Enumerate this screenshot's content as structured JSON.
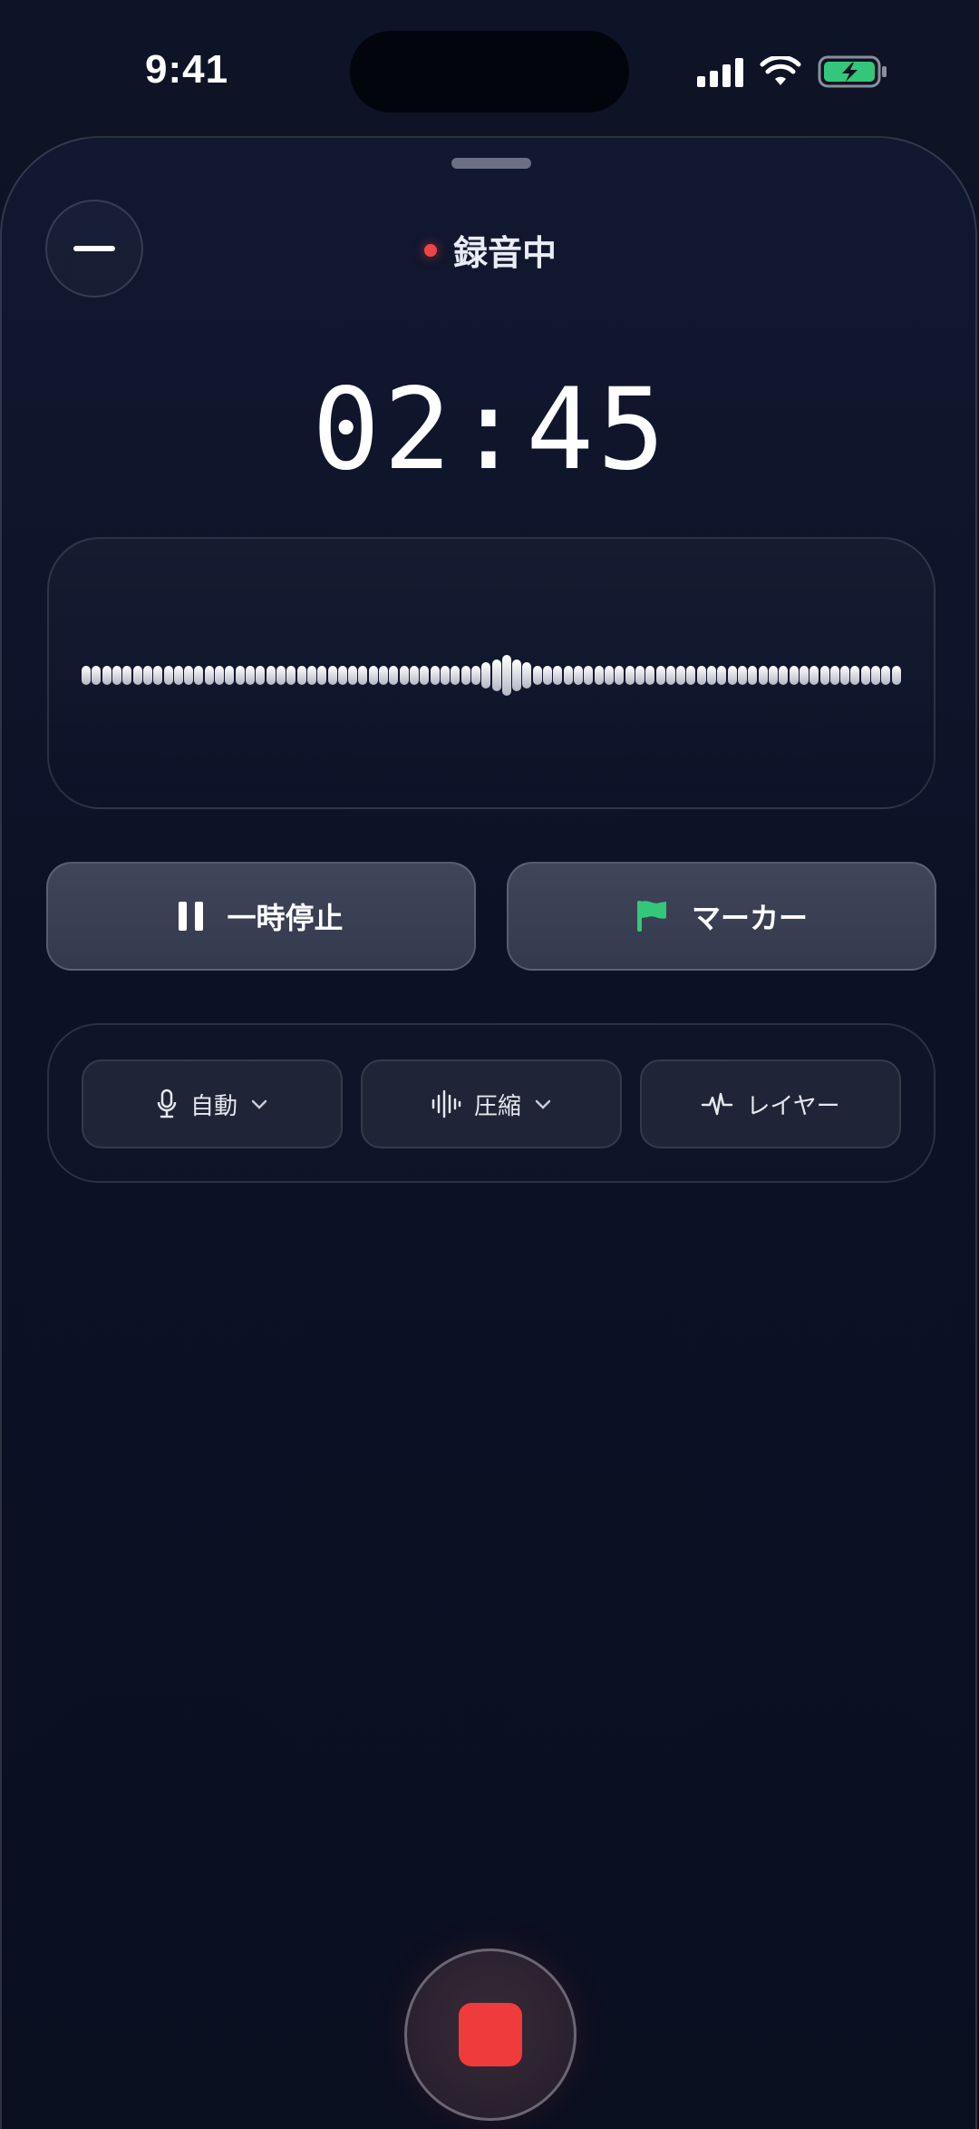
{
  "status_bar": {
    "time": "9:41",
    "icons": [
      "cellular-signal-icon",
      "wifi-icon",
      "battery-charging-icon"
    ],
    "battery_color": "#34c77b"
  },
  "header": {
    "minimize_icon": "minus-icon",
    "status_label": "録音中",
    "status_dot_color": "#ef4444"
  },
  "timer": {
    "elapsed": "02:45"
  },
  "waveform": {
    "bar_levels": [
      0.4,
      0.4,
      0.4,
      0.4,
      0.4,
      0.4,
      0.4,
      0.4,
      0.4,
      0.4,
      0.4,
      0.4,
      0.4,
      0.4,
      0.4,
      0.4,
      0.4,
      0.4,
      0.4,
      0.4,
      0.4,
      0.4,
      0.4,
      0.4,
      0.4,
      0.4,
      0.4,
      0.4,
      0.4,
      0.4,
      0.4,
      0.4,
      0.4,
      0.4,
      0.4,
      0.4,
      0.4,
      0.4,
      0.4,
      0.45,
      0.55,
      0.7,
      0.55,
      0.45,
      0.4,
      0.4,
      0.4,
      0.4,
      0.4,
      0.4,
      0.4,
      0.4,
      0.4,
      0.4,
      0.4,
      0.4,
      0.4,
      0.4,
      0.4,
      0.4,
      0.4,
      0.4,
      0.4,
      0.4,
      0.4,
      0.4,
      0.4,
      0.4,
      0.4,
      0.4,
      0.4,
      0.4,
      0.4,
      0.4,
      0.4,
      0.4,
      0.4,
      0.4,
      0.4,
      0.4
    ]
  },
  "controls": {
    "pause_label": "一時停止",
    "pause_icon": "pause-icon",
    "marker_label": "マーカー",
    "marker_icon": "flag-icon",
    "marker_icon_color": "#34c77b"
  },
  "options": [
    {
      "label": "自動",
      "icon": "microphone-icon",
      "has_dropdown": true
    },
    {
      "label": "圧縮",
      "icon": "waveform-icon",
      "has_dropdown": true
    },
    {
      "label": "レイヤー",
      "icon": "pulse-icon",
      "has_dropdown": false
    }
  ],
  "stop": {
    "icon": "stop-icon",
    "color": "#ef3b3b"
  }
}
